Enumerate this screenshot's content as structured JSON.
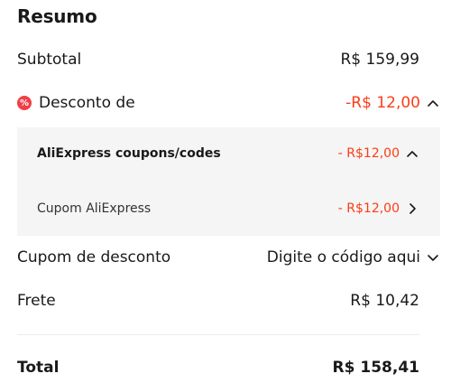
{
  "summary": {
    "title": "Resumo",
    "subtotal": {
      "label": "Subtotal",
      "value": "R$ 159,99"
    },
    "discount": {
      "label": "Desconto de",
      "value": "-R$ 12,00",
      "badge": "%"
    },
    "discount_details": [
      {
        "label": "AliExpress coupons/codes",
        "value": "- R$12,00"
      },
      {
        "label": "Cupom AliExpress",
        "value": "- R$12,00"
      }
    ],
    "coupon": {
      "label": "Cupom de desconto",
      "placeholder": "Digite o código aqui"
    },
    "shipping": {
      "label": "Frete",
      "value": "R$ 10,42"
    },
    "total": {
      "label": "Total",
      "value": "R$ 158,41"
    }
  },
  "colors": {
    "accent": "#fd3c16",
    "badge": "#f03f46",
    "panel": "#f5f5f5"
  },
  "icons": [
    "discount-badge-icon",
    "chevron-up-icon",
    "chevron-right-icon",
    "chevron-down-icon"
  ]
}
